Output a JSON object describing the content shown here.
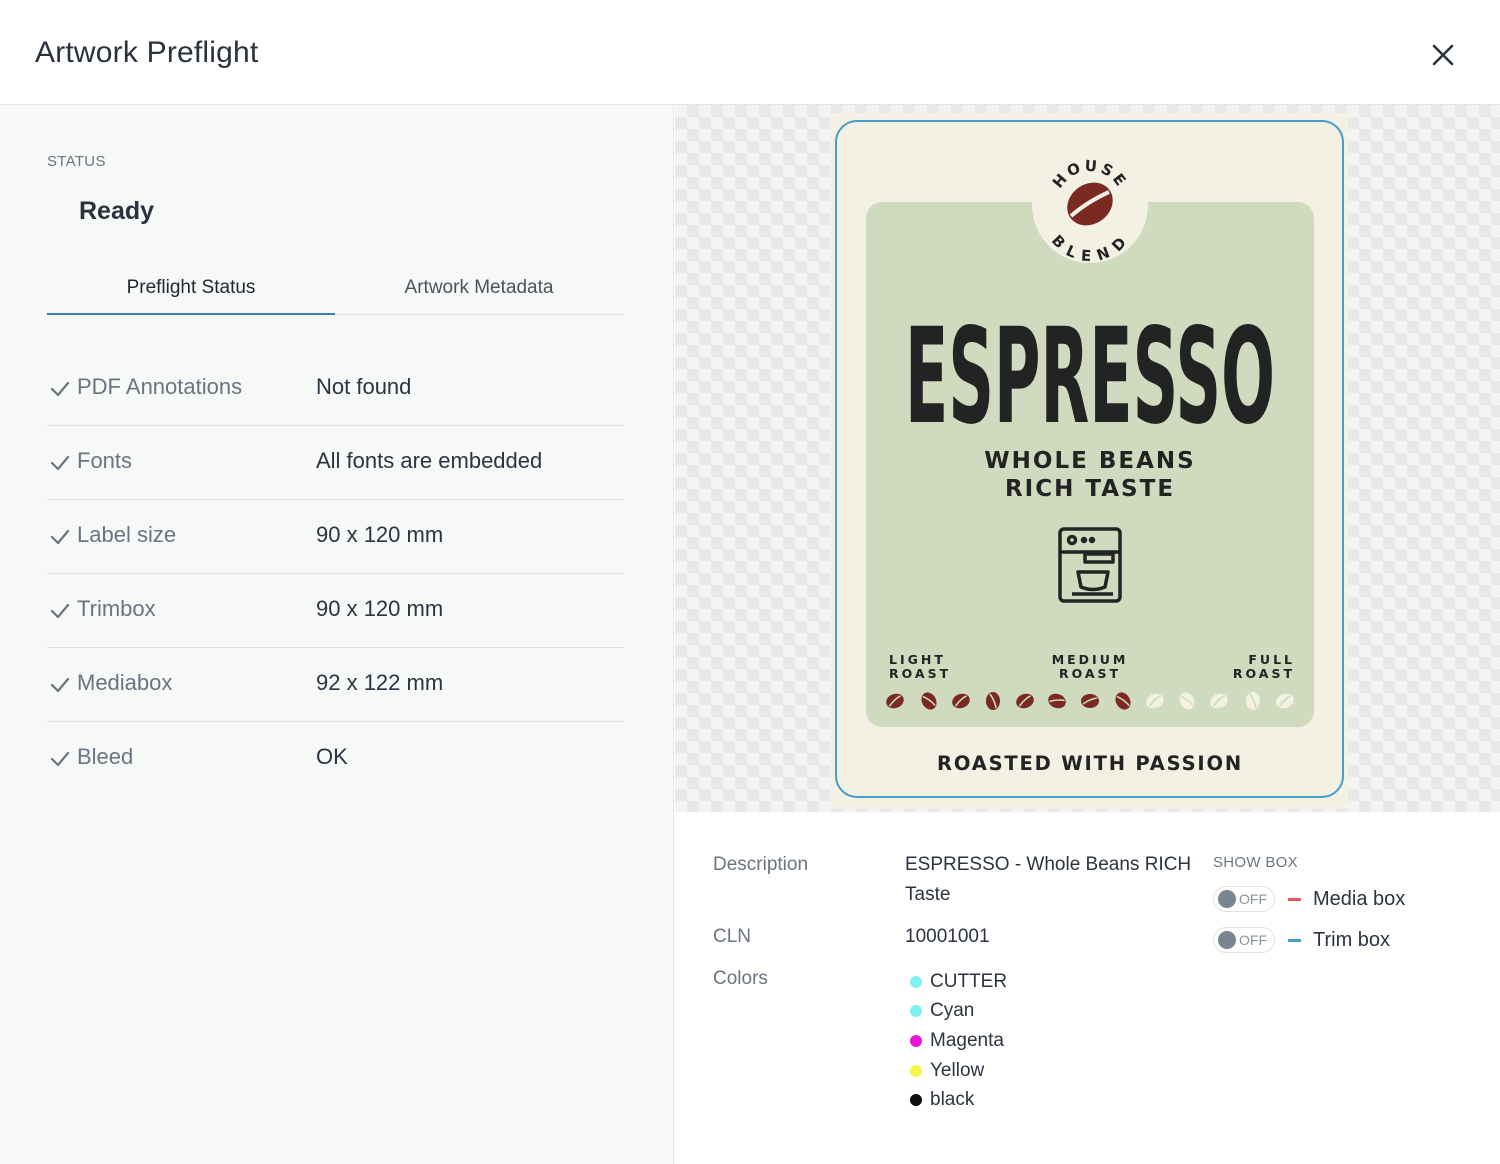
{
  "header": {
    "title": "Artwork Preflight"
  },
  "status": {
    "label": "STATUS",
    "value": "Ready"
  },
  "tabs": [
    {
      "label": "Preflight Status",
      "active": true
    },
    {
      "label": "Artwork Metadata",
      "active": false
    }
  ],
  "checks": [
    {
      "key": "PDF Annotations",
      "value": "Not found"
    },
    {
      "key": "Fonts",
      "value": "All fonts are embedded"
    },
    {
      "key": "Label size",
      "value": "90 x 120 mm"
    },
    {
      "key": "Trimbox",
      "value": "90 x 120 mm"
    },
    {
      "key": "Mediabox",
      "value": "92 x 122 mm"
    },
    {
      "key": "Bleed",
      "value": "OK"
    }
  ],
  "artwork": {
    "badge_top": "HOUSE",
    "badge_bottom": "BLEND",
    "title": "ESPRESSO",
    "subtitle_1": "WHOLE BEANS",
    "subtitle_2": "RICH TASTE",
    "roast_light_1": "LIGHT",
    "roast_light_2": "ROAST",
    "roast_medium_1": "MEDIUM",
    "roast_medium_2": "ROAST",
    "roast_full_1": "FULL",
    "roast_full_2": "ROAST",
    "footer": "ROASTED WITH PASSION",
    "colors": {
      "cream": "#f3f1e4",
      "panel": "#d0dabe",
      "bean_dark": "#7a2a22",
      "bean_light": "#f4f1e2",
      "ink": "#232323",
      "trim": "#4a9dc8"
    }
  },
  "info": {
    "description_label": "Description",
    "description_value": "ESPRESSO - Whole Beans RICH Taste",
    "cln_label": "CLN",
    "cln_value": "10001001",
    "colors_label": "Colors",
    "colors": [
      {
        "name": "CUTTER",
        "color": "#7ff0f5"
      },
      {
        "name": "Cyan",
        "color": "#7ff0f5"
      },
      {
        "name": "Magenta",
        "color": "#e81ad8"
      },
      {
        "name": "Yellow",
        "color": "#f6f64a"
      },
      {
        "name": "black",
        "color": "#111111"
      }
    ]
  },
  "show_box": {
    "label": "SHOW BOX",
    "toggles": [
      {
        "state": "OFF",
        "name": "Media box",
        "color": "#e0595d"
      },
      {
        "state": "OFF",
        "name": "Trim box",
        "color": "#4a9dc8"
      }
    ]
  }
}
